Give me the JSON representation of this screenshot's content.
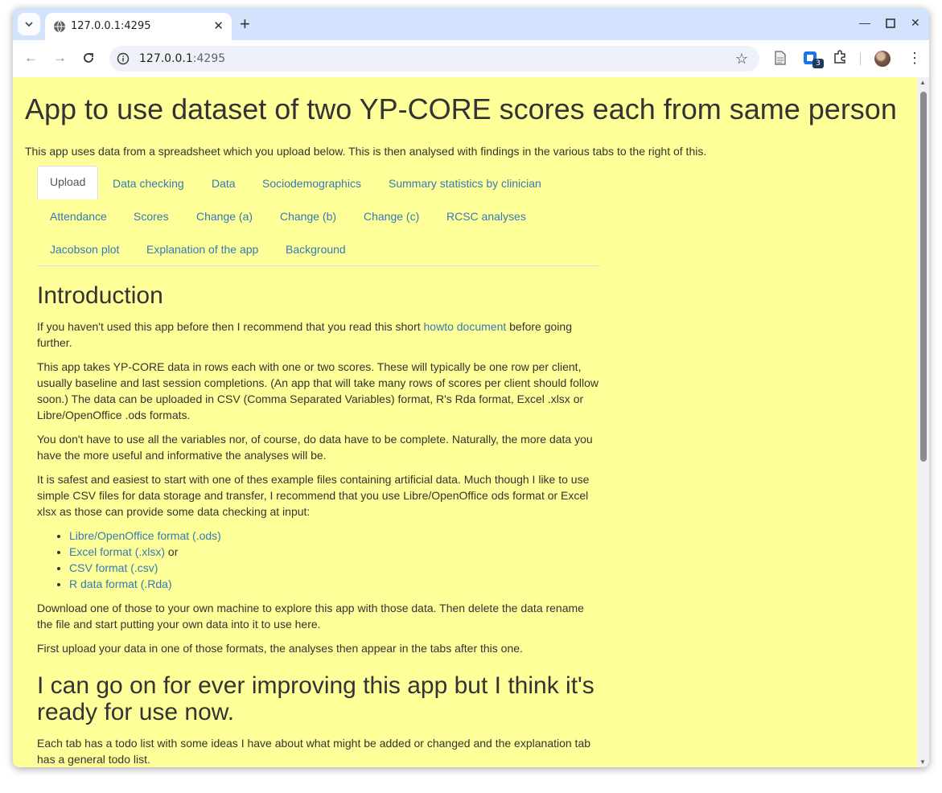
{
  "browser": {
    "tab_title": "127.0.0.1:4295",
    "url_host": "127.0.0.1",
    "url_port": ":4295",
    "extension_badge": "3"
  },
  "page": {
    "title": "App to use dataset of two YP-CORE scores each from same person",
    "intro": "This app uses data from a spreadsheet which you upload below. This is then analysed with findings in the various tabs to the right of this.",
    "tabs": [
      "Upload",
      "Data checking",
      "Data",
      "Sociodemographics",
      "Summary statistics by clinician",
      "Attendance",
      "Scores",
      "Change (a)",
      "Change (b)",
      "Change (c)",
      "RCSC analyses",
      "Jacobson plot",
      "Explanation of the app",
      "Background"
    ],
    "active_tab": "Upload",
    "section1": {
      "heading": "Introduction",
      "p1_before": "If you haven't used this app before then I recommend that you read this short ",
      "p1_link": "howto document",
      "p1_after": " before going further.",
      "p2": "This app takes YP-CORE data in rows each with one or two scores. These will typically be one row per client, usually baseline and last session completions. (An app that will take many rows of scores per client should follow soon.) The data can be uploaded in CSV (Comma Separated Variables) format, R's Rda format, Excel .xlsx or Libre/OpenOffice .ods formats.",
      "p3": "You don't have to use all the variables nor, of course, do data have to be complete. Naturally, the more data you have the more useful and informative the analyses will be.",
      "p4": "It is safest and easiest to start with one of thes example files containing artificial data. Much though I like to use simple CSV files for data storage and transfer, I recommend that you use Libre/OpenOffice ods format or Excel xlsx as those can provide some data checking at input:",
      "list": [
        {
          "link": "Libre/OpenOffice format (.ods)",
          "suffix": ""
        },
        {
          "link": "Excel format (.xlsx)",
          "suffix": " or"
        },
        {
          "link": "CSV format (.csv)",
          "suffix": ""
        },
        {
          "link": "R data format (.Rda)",
          "suffix": ""
        }
      ],
      "p5": "Download one of those to your own machine to explore this app with those data. Then delete the data rename the file and start putting your own data into it to use here.",
      "p6": "First upload your data in one of those formats, the analyses then appear in the tabs after this one."
    },
    "section2": {
      "heading": "I can go on for ever improving this app but I think it's ready for use now.",
      "p1": "Each tab has a todo list with some ideas I have about what might be added or changed and the explanation tab has a general todo list."
    }
  },
  "colors": {
    "page_background": "#ffff99",
    "link": "#337ab7",
    "text": "#333333"
  }
}
